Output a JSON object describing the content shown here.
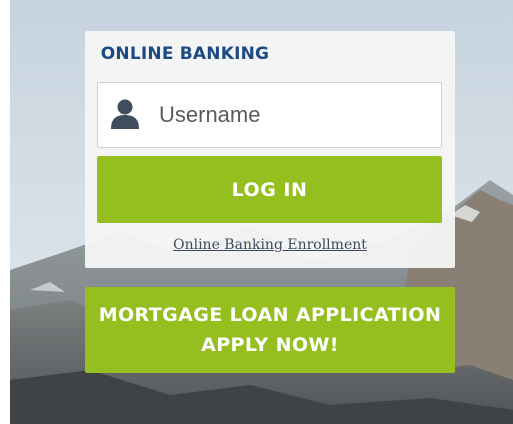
{
  "login": {
    "title": "ONLINE BANKING",
    "username_placeholder": "Username",
    "username_value": "",
    "login_label": "LOG IN",
    "enrollment_link": "Online Banking Enrollment"
  },
  "mortgage": {
    "line1": "MORTGAGE LOAN APPLICATION",
    "line2": "APPLY NOW!"
  },
  "icons": {
    "user": "user-icon"
  },
  "colors": {
    "accent_green": "#95bf1e",
    "title_blue": "#1d4a82",
    "card_bg": "#f5f5f5"
  }
}
